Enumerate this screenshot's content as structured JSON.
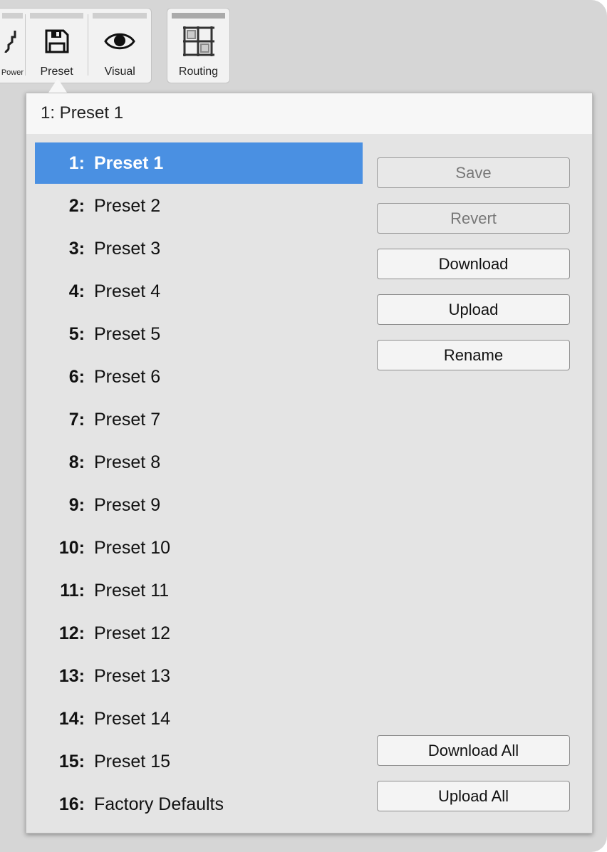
{
  "toolbar": {
    "items": [
      {
        "label": "Power",
        "icon": "plug-icon"
      },
      {
        "label": "Preset",
        "icon": "floppy-disk-icon"
      },
      {
        "label": "Visual",
        "icon": "eye-icon"
      },
      {
        "label": "Routing",
        "icon": "routing-grid-icon"
      }
    ]
  },
  "popover": {
    "title": "1: Preset 1",
    "presets": [
      {
        "num": "1:",
        "name": "Preset 1",
        "selected": true
      },
      {
        "num": "2:",
        "name": "Preset 2"
      },
      {
        "num": "3:",
        "name": "Preset 3"
      },
      {
        "num": "4:",
        "name": "Preset 4"
      },
      {
        "num": "5:",
        "name": "Preset 5"
      },
      {
        "num": "6:",
        "name": "Preset 6"
      },
      {
        "num": "7:",
        "name": "Preset 7"
      },
      {
        "num": "8:",
        "name": "Preset 8"
      },
      {
        "num": "9:",
        "name": "Preset 9"
      },
      {
        "num": "10:",
        "name": "Preset 10"
      },
      {
        "num": "11:",
        "name": "Preset 11"
      },
      {
        "num": "12:",
        "name": "Preset 12"
      },
      {
        "num": "13:",
        "name": "Preset 13"
      },
      {
        "num": "14:",
        "name": "Preset 14"
      },
      {
        "num": "15:",
        "name": "Preset 15"
      },
      {
        "num": "16:",
        "name": "Factory Defaults"
      }
    ],
    "buttons": {
      "save": "Save",
      "revert": "Revert",
      "download": "Download",
      "upload": "Upload",
      "rename": "Rename",
      "download_all": "Download All",
      "upload_all": "Upload All"
    },
    "selected_color": "#4a90e2"
  }
}
